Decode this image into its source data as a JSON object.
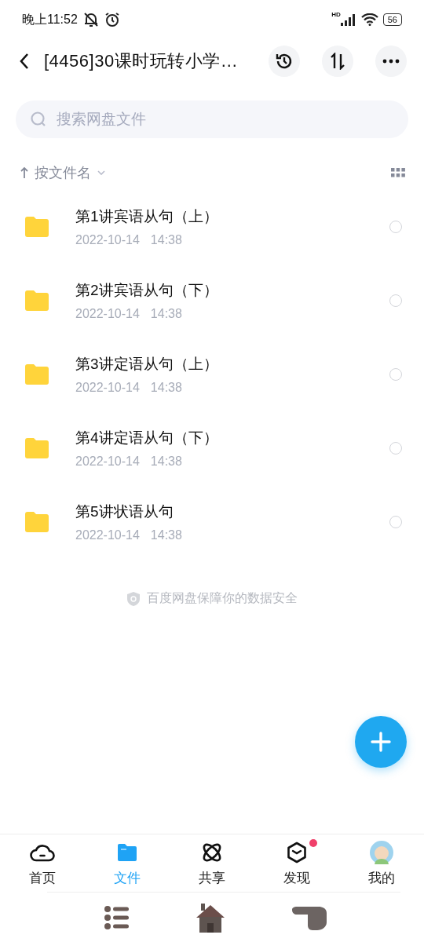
{
  "status_bar": {
    "time": "晚上11:52",
    "network": "HD",
    "battery": "56"
  },
  "header": {
    "title": "[4456]30课时玩转小学…"
  },
  "search": {
    "placeholder": "搜索网盘文件"
  },
  "sort": {
    "label": "按文件名"
  },
  "files": [
    {
      "name": "第1讲宾语从句（上）",
      "date": "2022-10-14",
      "time": "14:38",
      "selected": false
    },
    {
      "name": "第2讲宾语从句（下）",
      "date": "2022-10-14",
      "time": "14:38",
      "selected": false
    },
    {
      "name": "第3讲定语从句（上）",
      "date": "2022-10-14",
      "time": "14:38",
      "selected": false
    },
    {
      "name": "第4讲定语从句（下）",
      "date": "2022-10-14",
      "time": "14:38",
      "selected": false
    },
    {
      "name": "第5讲状语从句",
      "date": "2022-10-14",
      "time": "14:38",
      "selected": false
    }
  ],
  "footer_note": "百度网盘保障你的数据安全",
  "tab_bar": [
    {
      "label": "首页",
      "kind": "home",
      "selected": false,
      "badge": false
    },
    {
      "label": "文件",
      "kind": "files",
      "selected": true,
      "badge": false
    },
    {
      "label": "共享",
      "kind": "share",
      "selected": false,
      "badge": false
    },
    {
      "label": "发现",
      "kind": "discover",
      "selected": false,
      "badge": true
    },
    {
      "label": "我的",
      "kind": "profile",
      "selected": false,
      "badge": false
    }
  ]
}
